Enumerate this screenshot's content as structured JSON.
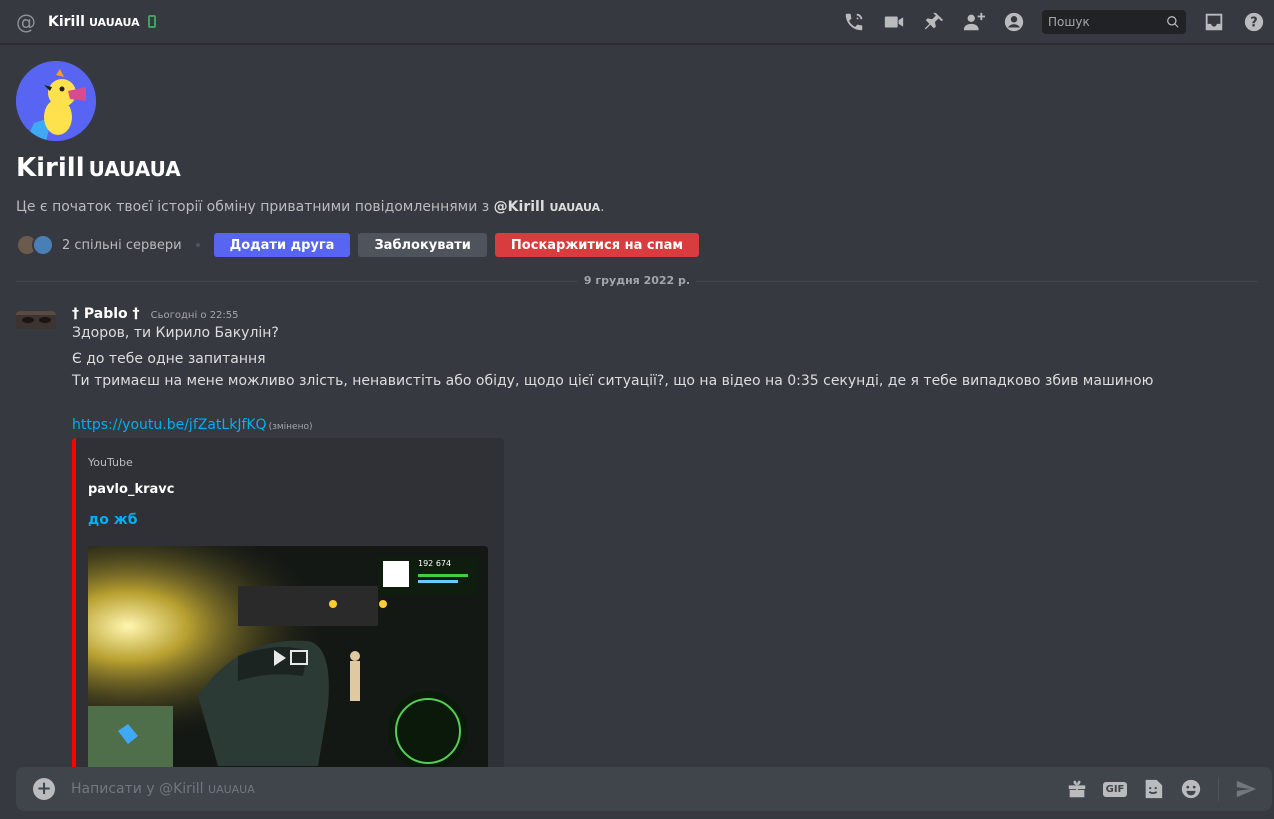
{
  "header": {
    "name": "Kirill",
    "tag": "UAUAUA",
    "search_placeholder": "Пошук"
  },
  "profile": {
    "name": "Kirill",
    "tag": "UAUAUA",
    "intro_prefix": "Це є початок твоєї історії обміну приватними повідомленнями з ",
    "intro_mention": "@Kirill",
    "intro_tag": "UAUAUA",
    "intro_suffix": ".",
    "mutual_servers": "2 спільні сервери",
    "add_friend": "Додати друга",
    "block": "Заблокувати",
    "report_spam": "Поскаржитися на спам"
  },
  "date_divider": "9 грудня 2022 р.",
  "message": {
    "author": "† Pablo †",
    "timestamp": "Сьогодні о 22:55",
    "lines": [
      "Здоров, ти Кирило Бакулін?",
      "Є до тебе одне запитання",
      "Ти тримаєш на мене можливо злість, ненавистіть або обіду, щодо цієї ситуації?, що на відео на 0:35 секунді, де я тебе випадково збив машиною"
    ],
    "link": "https://youtu.be/jfZatLkJfKQ",
    "edited": "(змінено)",
    "embed": {
      "provider": "YouTube",
      "author": "pavlo_kravc",
      "title": "до жб",
      "accent_color": "#ff0000",
      "hud_money": "192 674"
    }
  },
  "composer": {
    "placeholder_prefix": "Написати у @Kirill",
    "placeholder_tag": "UAUAUA",
    "gif_label": "GIF"
  },
  "colors": {
    "accent": "#5865f2",
    "danger": "#d83c3e",
    "link": "#00aff4",
    "online_mobile": "#3ba55c"
  }
}
